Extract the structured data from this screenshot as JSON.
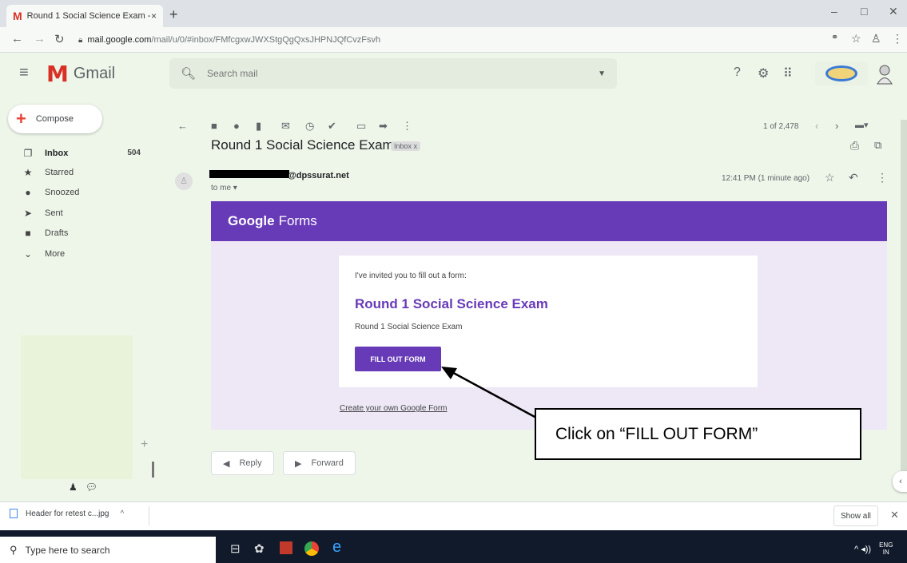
{
  "browser": {
    "tab_title": "Round 1 Social Science Exam - In",
    "tab_favicon": "M",
    "new_tab": "+",
    "url_host": "mail.google.com",
    "url_path": "/mail/u/0/#inbox/FMfcgxwJWXStgQgQxsJHPNJQfCvzFsvh",
    "tab_close": "×",
    "win_min": "–",
    "win_max": "□",
    "win_close": "✕"
  },
  "gmail": {
    "logo_word": "Gmail",
    "logo_m": "M",
    "search_placeholder": "Search mail"
  },
  "sidebar": {
    "compose_label": "Compose",
    "items": [
      {
        "icon": "❐",
        "label": "Inbox",
        "count": "504"
      },
      {
        "icon": "★",
        "label": "Starred",
        "count": ""
      },
      {
        "icon": "●",
        "label": "Snoozed",
        "count": ""
      },
      {
        "icon": "➤",
        "label": "Sent",
        "count": ""
      },
      {
        "icon": "■",
        "label": "Drafts",
        "count": ""
      },
      {
        "icon": "⌄",
        "label": "More",
        "count": ""
      }
    ],
    "add_label": "+"
  },
  "toolbar": {
    "page_count": "1 of 2,478"
  },
  "message": {
    "subject": "Round 1 Social Science Exam",
    "label_chip": "Inbox x",
    "sender": "@dpssurat.net",
    "to": "to me ▾",
    "time": "12:41 PM (1 minute ago)"
  },
  "form_email": {
    "brand_google": "Google",
    "brand_forms": "Forms",
    "invite_text": "I've invited you to fill out a form:",
    "form_title": "Round 1 Social Science Exam",
    "form_description": "Round 1 Social Science Exam",
    "fill_button": "FILL OUT FORM",
    "create_link": "Create your own Google Form"
  },
  "actions": {
    "reply": "Reply",
    "forward": "Forward"
  },
  "annotation": {
    "callout_text": "Click on “FILL OUT FORM”"
  },
  "downloads": {
    "file_name": "Header for retest c...jpg",
    "show_all": "Show all",
    "close": "✕"
  },
  "taskbar": {
    "search_placeholder": "Type here to search",
    "lang_top": "ENG",
    "lang_bottom": "IN"
  },
  "colors": {
    "forms_purple": "#673ab7",
    "forms_lavender": "#ede7f6",
    "gmail_red": "#d93025",
    "sidebar_bg": "#eef6ea"
  }
}
